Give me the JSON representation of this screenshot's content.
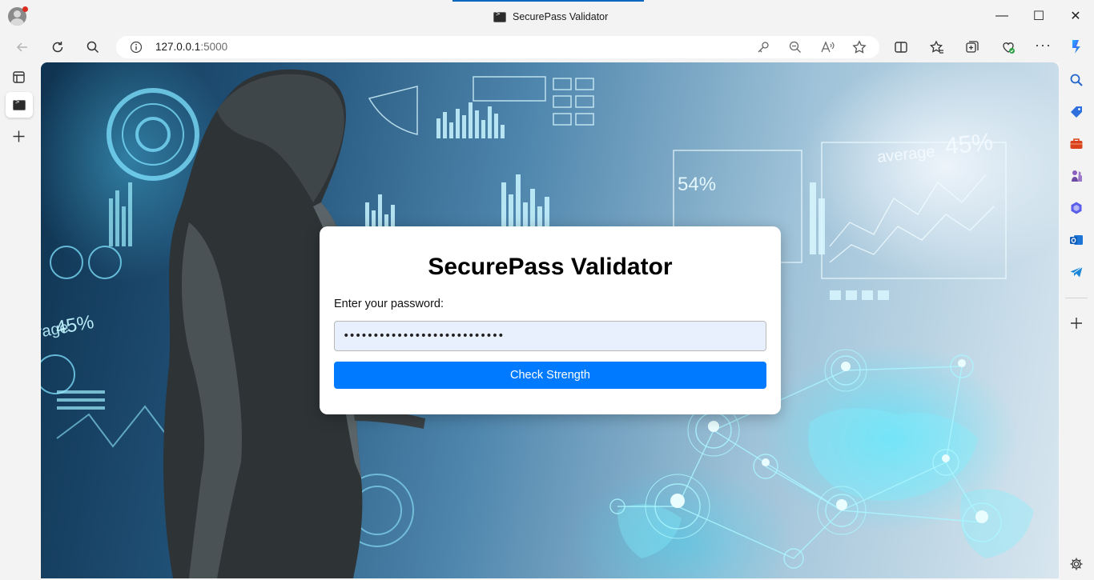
{
  "window": {
    "title": "SecurePass Validator",
    "minimize_label": "—",
    "maximize_label": "☐",
    "close_label": "✕"
  },
  "address_bar": {
    "host": "127.0.0.1",
    "port": ":5000"
  },
  "page": {
    "heading": "SecurePass Validator",
    "password_label": "Enter your password:",
    "password_value": "•••••••••••••••••••••••••••",
    "submit_label": "Check Strength"
  },
  "background": {
    "overlay_texts": {
      "average": "average",
      "pct_45_right": "45%",
      "pct_54": "54%",
      "pct_45_left": "45%",
      "age_fragment": "rage"
    }
  },
  "colors": {
    "accent": "#007bff",
    "input_fill": "#e8f0fe",
    "tab_accent": "#0067c0"
  }
}
